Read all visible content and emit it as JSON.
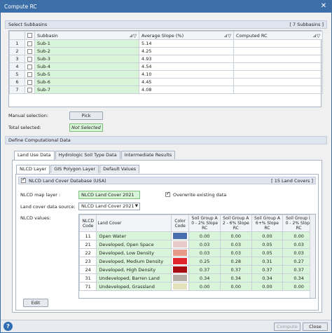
{
  "window": {
    "title": "Compute RC",
    "close_glyph": "✕"
  },
  "subbasins_section": {
    "title": "Select Subbasins",
    "count_label": "[ 7 Subbasins ]",
    "columns": {
      "subbasin": "Subbasin",
      "avg_slope": "Average Slope (%)",
      "computed_rc": "Computed RC",
      "sort_glyph": "⊿▽"
    },
    "rows": [
      {
        "num": "1",
        "name": "Sub-1",
        "slope": "5.14",
        "rc": ""
      },
      {
        "num": "2",
        "name": "Sub-2",
        "slope": "4.25",
        "rc": ""
      },
      {
        "num": "3",
        "name": "Sub-3",
        "slope": "4.93",
        "rc": ""
      },
      {
        "num": "4",
        "name": "Sub-4",
        "slope": "4.54",
        "rc": ""
      },
      {
        "num": "5",
        "name": "Sub-5",
        "slope": "4.10",
        "rc": ""
      },
      {
        "num": "6",
        "name": "Sub-6",
        "slope": "4.45",
        "rc": ""
      },
      {
        "num": "7",
        "name": "Sub-7",
        "slope": "4.08",
        "rc": ""
      }
    ],
    "manual_selection_label": "Manual selection:",
    "pick_label": "Pick",
    "total_selected_label": "Total selected:",
    "total_selected_value": "Not Selected"
  },
  "computational_section": {
    "title": "Define Computational Data",
    "tabs": [
      "Land Use Data",
      "Hydrologic Soil Type Data",
      "Intermediate Results"
    ],
    "subtabs": [
      "NLCD Layer",
      "GIS Polygon Layer",
      "Default Values"
    ],
    "nlcd_header": "NLCD Land Cover Database (USA)",
    "nlcd_count": "[ 15 Land Covers ]",
    "map_layer_label": "NLCD map layer :",
    "map_layer_value": "NLCD Land Cover 2021",
    "overwrite_label": "Overwrite existing data",
    "data_source_label": "Land cover data source:",
    "data_source_value": "NLCD Land Cover 2021",
    "nlcd_values_label": "NLCD values:",
    "edit_label": "Edit",
    "table_headers": {
      "code": "NLCD Code",
      "cover": "Land Cover",
      "color": "Color Code",
      "a": "Soil Group A 0 - 2% Slope RC",
      "b": "Soil Group A 2 - 6% Slope RC",
      "c": "Soil Group A 6+% Slope RC",
      "d": "Soil Group B 0 - 2% Slope RC"
    },
    "table_rows": [
      {
        "code": "11",
        "cover": "Open Water",
        "color": "#4a6fb0",
        "a": "0.00",
        "b": "0.00",
        "c": "0.00",
        "d": "0.00"
      },
      {
        "code": "21",
        "cover": "Developed, Open Space",
        "color": "#e8c9c9",
        "a": "0.03",
        "b": "0.03",
        "c": "0.05",
        "d": "0.03"
      },
      {
        "code": "22",
        "cover": "Developed, Low Density",
        "color": "#e59a8a",
        "a": "0.03",
        "b": "0.03",
        "c": "0.05",
        "d": "0.03"
      },
      {
        "code": "23",
        "cover": "Developed, Medium Density",
        "color": "#e0242c",
        "a": "0.25",
        "b": "0.28",
        "c": "0.31",
        "d": "0.27"
      },
      {
        "code": "24",
        "cover": "Developed, High Density",
        "color": "#a80c12",
        "a": "0.37",
        "b": "0.37",
        "c": "0.37",
        "d": "0.37"
      },
      {
        "code": "31",
        "cover": "Undeveloped, Barren Land",
        "color": "#b6ada4",
        "a": "0.34",
        "b": "0.34",
        "c": "0.34",
        "d": "0.34"
      },
      {
        "code": "71",
        "cover": "Undeveloped, Grassland",
        "color": "#e4e2bd",
        "a": "0.00",
        "b": "0.00",
        "c": "0.00",
        "d": "0.00"
      }
    ]
  },
  "footer": {
    "help_glyph": "?",
    "compute_label": "Compute",
    "close_label": "Close"
  }
}
